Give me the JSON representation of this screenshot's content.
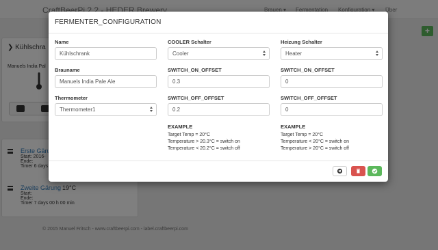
{
  "app": {
    "brand": "CraftBeerPi 2.2 - HEDER Brewery",
    "nav": [
      "Brauen ▾",
      "Fermentation",
      "Konfiguration ▾",
      "Über"
    ]
  },
  "background": {
    "panel_title": "Kühlschra",
    "panel_sub": "Manuels India Pal",
    "steps": [
      {
        "title": "Erste Gärung",
        "temp": "",
        "start": "Start: 2016-",
        "end": "Ende:",
        "timer": "Timer 6 days"
      },
      {
        "title": "Zweite Gärung",
        "temp": "19°C",
        "start": "Start:",
        "end": "Ende:",
        "timer": "Timer 7 days 00 h 00 min"
      }
    ],
    "footer": "© 2015 Manuel Fritsch - www.craftbeerpi.com - label.craftbeerpi.com",
    "add_button": "+"
  },
  "modal": {
    "title": "FERMENTER_CONFIGURATION",
    "col1": {
      "name_label": "Name",
      "name_value": "Kühlschrank",
      "brew_label": "Brauname",
      "brew_value": "Manuels India Pale Ale",
      "thermo_label": "Thermometer",
      "thermo_value": "Thermometer1"
    },
    "col2": {
      "cooler_label": "COOLER Schalter",
      "cooler_value": "Cooler",
      "on_label": "SWITCH_ON_OFFSET",
      "on_value": "0.3",
      "off_label": "SWITCH_OFF_OFFSET",
      "off_value": "0.2",
      "example_title": "EXAMPLE",
      "example_lines": [
        "Target Temp = 20°C",
        "Temperature > 20.3°C = switch on",
        "Temperature < 20.2°C = switch off"
      ]
    },
    "col3": {
      "heater_label": "Heizung Schalter",
      "heater_value": "Heater",
      "on_label": "SWITCH_ON_OFFSET",
      "on_value": "0",
      "off_label": "SWITCH_OFF_OFFSET",
      "off_value": "0",
      "example_title": "EXAMPLE",
      "example_lines": [
        "Target Temp = 20°C",
        "Temperature < 20°C = switch on",
        "Temperature > 20°C = switch off"
      ]
    }
  },
  "colors": {
    "success": "#5cb85c",
    "danger": "#d9534f",
    "link": "#337ab7"
  }
}
